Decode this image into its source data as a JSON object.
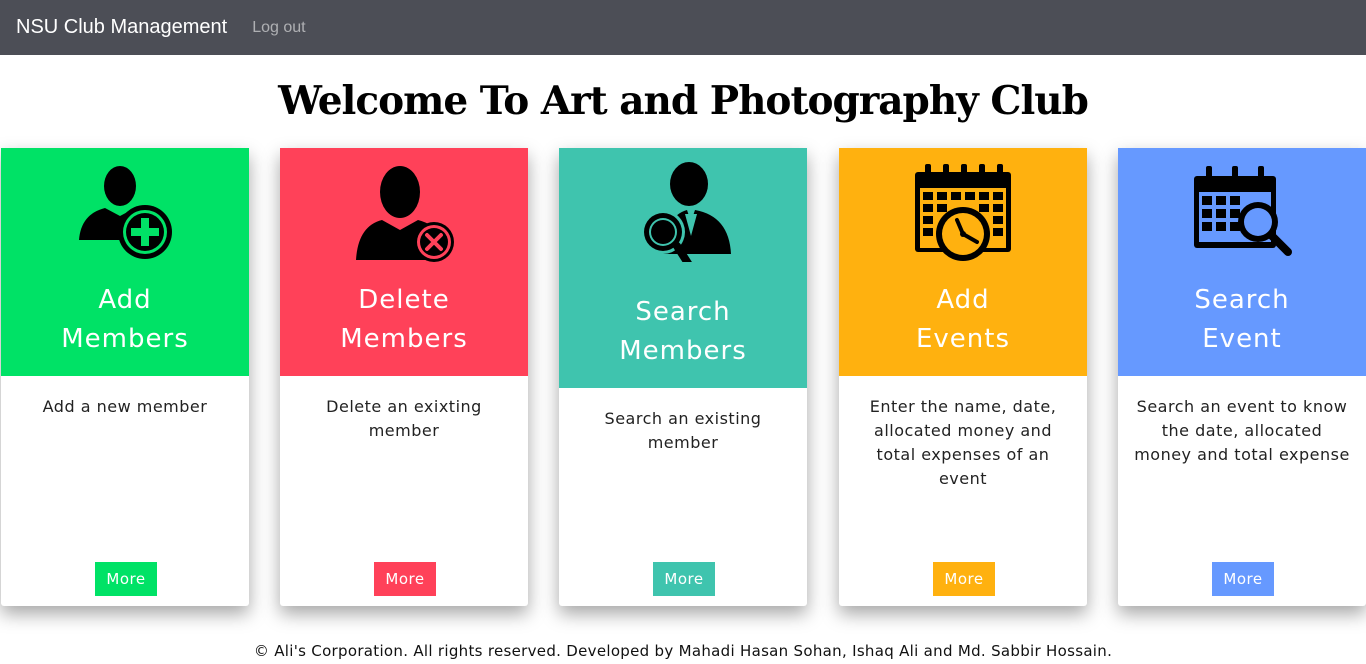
{
  "navbar": {
    "brand": "NSU Club Management",
    "logout_label": "Log out"
  },
  "page_title": "Welcome To Art and Photography Club",
  "colors": {
    "green": "#00e266",
    "red": "#ff4159",
    "teal": "#3fc4ae",
    "orange": "#ffb10f",
    "blue": "#6699ff",
    "navbar": "#4c4e56"
  },
  "cards": [
    {
      "title_line1": "Add",
      "title_line2": "Members",
      "description": "Add a new member",
      "button_label": "More",
      "icon": "add-user-icon"
    },
    {
      "title_line1": "Delete",
      "title_line2": "Members",
      "description": "Delete an exixting member",
      "button_label": "More",
      "icon": "delete-user-icon"
    },
    {
      "title_line1": "Search",
      "title_line2": "Members",
      "description": "Search an existing member",
      "button_label": "More",
      "icon": "search-user-icon"
    },
    {
      "title_line1": "Add",
      "title_line2": "Events",
      "description": "Enter the name, date, allocated money and total expenses of an event",
      "button_label": "More",
      "icon": "calendar-clock-icon"
    },
    {
      "title_line1": "Search",
      "title_line2": "Event",
      "description": "Search an event to know the date, allocated money and total expense",
      "button_label": "More",
      "icon": "calendar-search-icon"
    }
  ],
  "footer": "© Ali's Corporation. All rights reserved. Developed by Mahadi Hasan Sohan, Ishaq Ali and Md. Sabbir Hossain."
}
